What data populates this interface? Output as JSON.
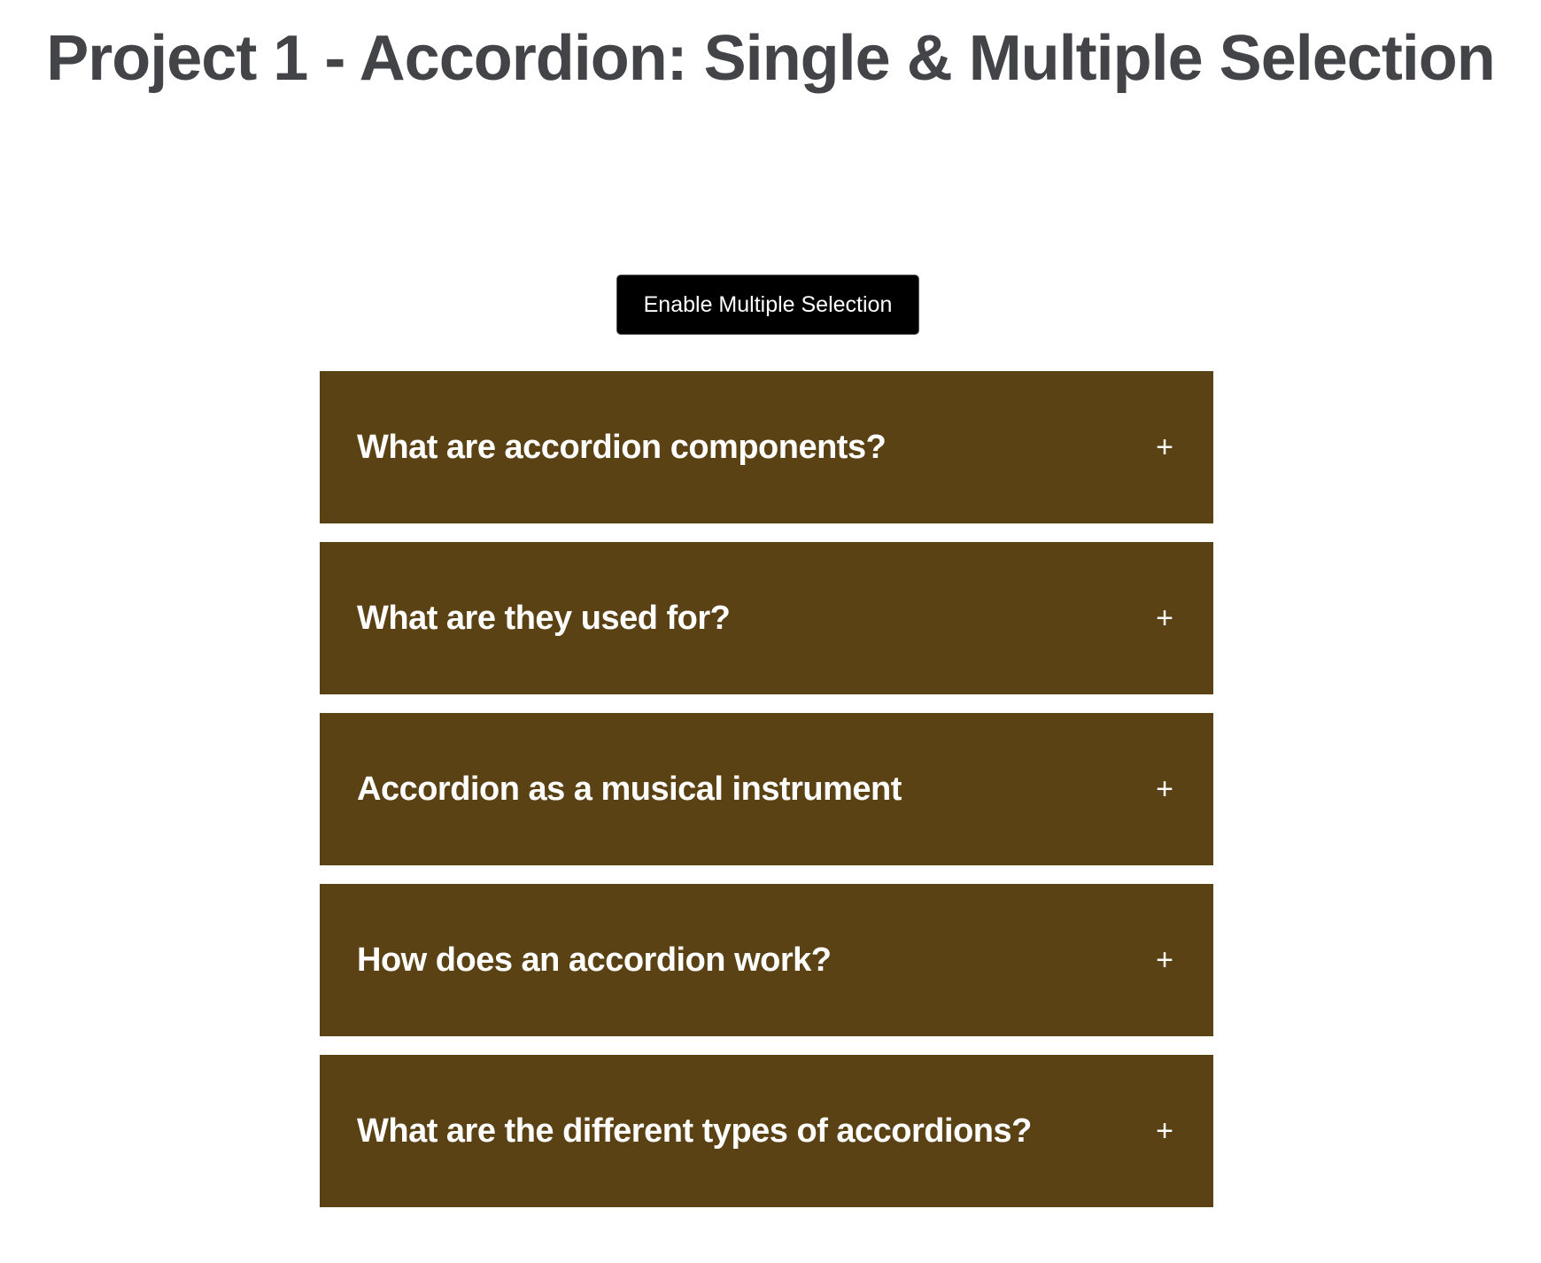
{
  "page": {
    "title": "Project 1 - Accordion: Single & Multiple Selection"
  },
  "controls": {
    "toggle_label": "Enable Multiple Selection"
  },
  "accordion": {
    "expand_symbol": "+",
    "items": [
      {
        "question": "What are accordion components?"
      },
      {
        "question": "What are they used for?"
      },
      {
        "question": "Accordion as a musical instrument"
      },
      {
        "question": "How does an accordion work?"
      },
      {
        "question": "What are the different types of accordions?"
      }
    ]
  },
  "colors": {
    "title": "#434448",
    "accordion_background": "#5b4215",
    "button_background": "#000000",
    "text_light": "#ffffff"
  },
  "icons": {
    "expand": "plus-icon"
  }
}
